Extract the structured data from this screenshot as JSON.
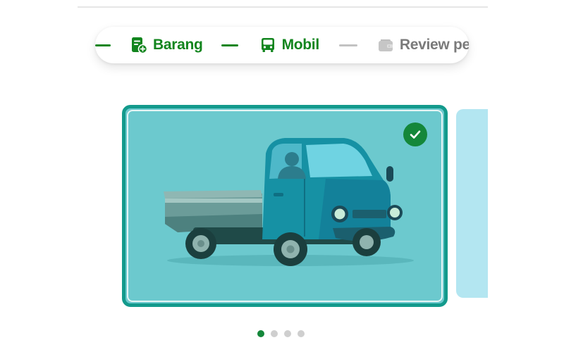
{
  "stepper": {
    "steps": [
      {
        "label": "Barang",
        "icon": "package-add-icon",
        "state": "done"
      },
      {
        "label": "Mobil",
        "icon": "vehicle-icon",
        "state": "done"
      },
      {
        "label": "Review pesanan",
        "icon": "wallet-icon",
        "state": "pending"
      }
    ]
  },
  "carousel": {
    "selected_index": 0,
    "total_pages": 4,
    "cards": [
      {
        "vehicle": "pickup-truck-icon",
        "selected": true
      },
      {
        "vehicle": "unknown",
        "selected": false
      }
    ]
  },
  "colors": {
    "accent_green": "#12851e",
    "inactive_grey": "#7a7a7a",
    "card_border": "#139a8c",
    "card_bg": "#6cc9ce",
    "next_card_bg": "#b3e6f1"
  }
}
